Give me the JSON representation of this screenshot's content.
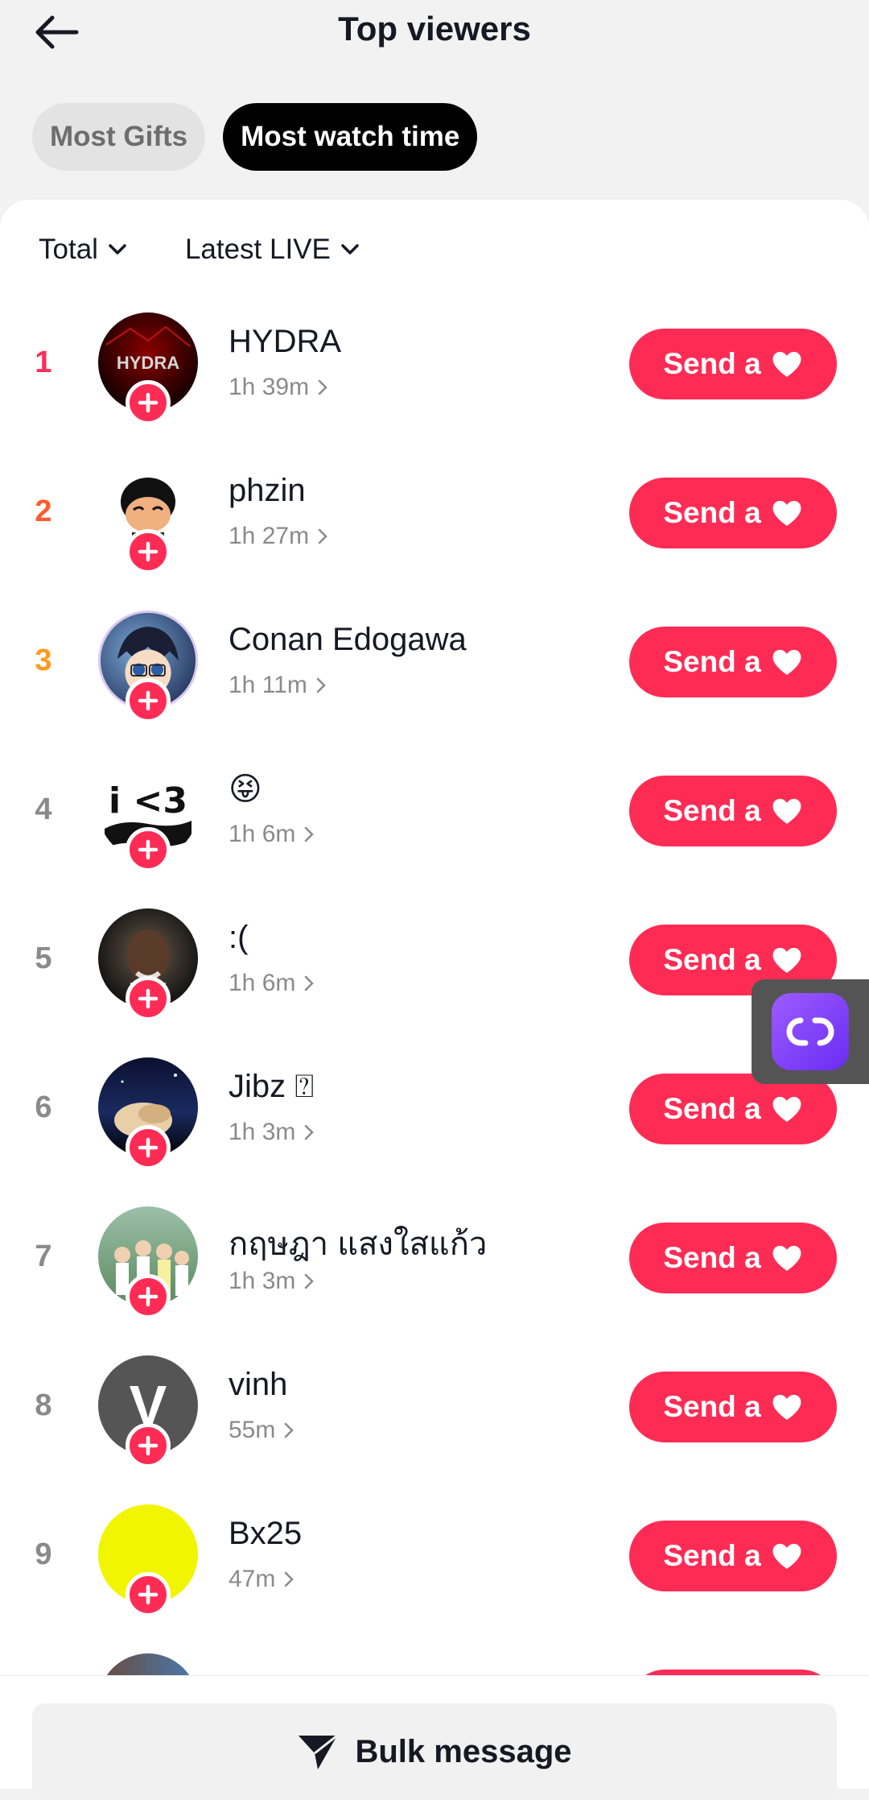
{
  "header": {
    "title": "Top viewers",
    "back_icon": "arrow-left-icon"
  },
  "tabs": [
    {
      "label": "Most Gifts",
      "active": false
    },
    {
      "label": "Most watch time",
      "active": true
    }
  ],
  "filters": [
    {
      "label": "Total",
      "icon": "chevron-down-icon"
    },
    {
      "label": "Latest LIVE",
      "icon": "chevron-down-icon"
    }
  ],
  "send_button_label": "Send a",
  "colors": {
    "accent": "#fe2c55",
    "rank1": "#fe2c55",
    "rank2": "#ff5a2d",
    "rank3": "#ff9a1f",
    "rank_default": "#8a8a8a"
  },
  "viewers": [
    {
      "rank": "1",
      "name": "HYDRA",
      "time": "1h 39m",
      "avatar_text": "HYDRA"
    },
    {
      "rank": "2",
      "name": "phzin",
      "time": "1h 27m"
    },
    {
      "rank": "3",
      "name": "Conan Edogawa",
      "time": "1h 11m"
    },
    {
      "rank": "4",
      "name": "😝",
      "time": "1h 6m",
      "avatar_text": "i <3"
    },
    {
      "rank": "5",
      "name": ":(",
      "time": "1h 6m"
    },
    {
      "rank": "6",
      "name": "Jibz ⍰",
      "time": "1h 3m"
    },
    {
      "rank": "7",
      "name": "กฤษฎา แสงใสแก้ว",
      "time": "1h 3m"
    },
    {
      "rank": "8",
      "name": "vinh",
      "time": "55m",
      "avatar_text": "V"
    },
    {
      "rank": "9",
      "name": "Bx25",
      "time": "47m"
    }
  ],
  "bulk": {
    "label": "Bulk message",
    "icon": "paper-plane-icon"
  },
  "floating_icon": "infinity-link-icon"
}
